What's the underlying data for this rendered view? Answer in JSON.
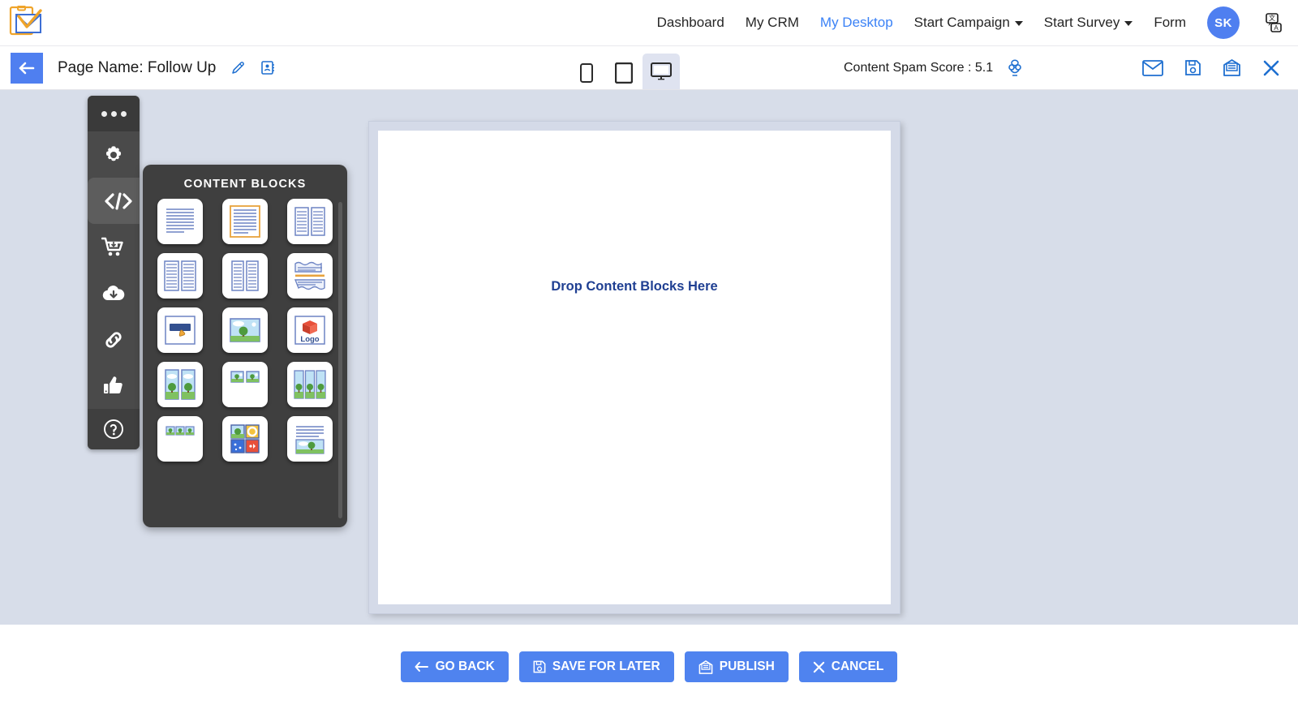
{
  "brand": {
    "logo_name": "email-clipboard-logo",
    "accent_blue": "#4f7ff0",
    "accent_orange": "#efa42a"
  },
  "topnav": {
    "items": [
      {
        "label": "Dashboard",
        "active": false,
        "dropdown": false
      },
      {
        "label": "My CRM",
        "active": false,
        "dropdown": false
      },
      {
        "label": "My Desktop",
        "active": true,
        "dropdown": false
      },
      {
        "label": "Start Campaign",
        "active": false,
        "dropdown": true
      },
      {
        "label": "Start Survey",
        "active": false,
        "dropdown": true
      },
      {
        "label": "Form",
        "active": false,
        "dropdown": false
      }
    ],
    "avatar_initials": "SK",
    "translate_icon": "translate-icon"
  },
  "toolbar": {
    "back_icon": "arrow-left-icon",
    "page_name": "Page Name: Follow Up",
    "edit_icon": "pencil-icon",
    "contact_icon": "contact-card-icon",
    "devices": [
      {
        "name": "mobile",
        "icon": "mobile-icon",
        "active": false
      },
      {
        "name": "tablet",
        "icon": "tablet-icon",
        "active": false
      },
      {
        "name": "desktop",
        "icon": "desktop-icon",
        "active": true
      }
    ],
    "spam_score_label": "Content Spam Score : 5.1",
    "spam_icon": "spy-icon",
    "right_icons": [
      {
        "name": "envelope-icon"
      },
      {
        "name": "save-disk-icon"
      },
      {
        "name": "inbox-mail-icon"
      },
      {
        "name": "close-icon"
      }
    ]
  },
  "sidebar": {
    "menu_icon": "three-dots-icon",
    "items": [
      {
        "name": "settings",
        "icon": "gear-icon",
        "active": false
      },
      {
        "name": "content-blocks",
        "icon": "code-icon",
        "active": true
      },
      {
        "name": "ecommerce",
        "icon": "shopping-cart-icon",
        "active": false
      },
      {
        "name": "download",
        "icon": "cloud-download-icon",
        "active": false
      },
      {
        "name": "links",
        "icon": "chain-link-icon",
        "active": false
      },
      {
        "name": "social",
        "icon": "thumbs-up-icon",
        "active": false
      }
    ],
    "help_icon": "help-circle-icon"
  },
  "content_blocks": {
    "title": "CONTENT BLOCKS",
    "blocks": [
      {
        "name": "text-lines-block",
        "type": "text"
      },
      {
        "name": "bordered-text-block",
        "type": "text-boxed"
      },
      {
        "name": "two-column-text-block",
        "type": "two-col"
      },
      {
        "name": "two-column-text-block-alt",
        "type": "two-col"
      },
      {
        "name": "two-column-narrow-text-block",
        "type": "two-col"
      },
      {
        "name": "divider-block",
        "type": "divider"
      },
      {
        "name": "button-block",
        "type": "button"
      },
      {
        "name": "image-block",
        "type": "image"
      },
      {
        "name": "logo-block",
        "type": "logo",
        "label": "Logo"
      },
      {
        "name": "two-image-block",
        "type": "img2"
      },
      {
        "name": "two-small-image-block",
        "type": "img2-small"
      },
      {
        "name": "three-image-block",
        "type": "img3"
      },
      {
        "name": "three-small-image-block",
        "type": "img3-small"
      },
      {
        "name": "image-grid-block",
        "type": "grid4"
      },
      {
        "name": "text-with-image-block",
        "type": "text-image"
      }
    ]
  },
  "canvas": {
    "drop_text": "Drop Content Blocks Here"
  },
  "footer": {
    "buttons": [
      {
        "name": "go-back-button",
        "label": "GO BACK",
        "icon": "arrow-left-icon"
      },
      {
        "name": "save-for-later-button",
        "label": "SAVE FOR LATER",
        "icon": "save-disk-icon"
      },
      {
        "name": "publish-button",
        "label": "PUBLISH",
        "icon": "inbox-mail-icon"
      },
      {
        "name": "cancel-button",
        "label": "CANCEL",
        "icon": "close-icon"
      }
    ]
  }
}
